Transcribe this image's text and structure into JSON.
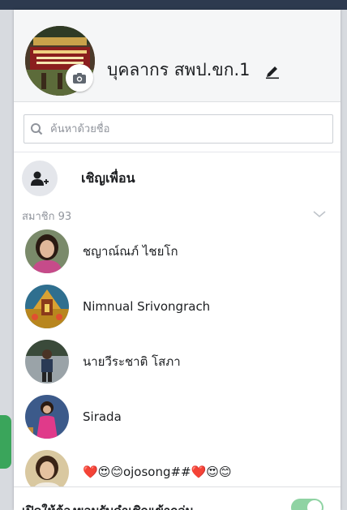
{
  "group": {
    "name": "บุคลากร สพป.ขก.1"
  },
  "search": {
    "placeholder": "ค้นหาด้วยชื่อ"
  },
  "invite": {
    "label": "เชิญเพื่อน"
  },
  "members": {
    "header": "สมาชิก 93",
    "list": [
      {
        "name": "ชญาณ์ณภ์ ไชยโก"
      },
      {
        "name": "Nimnual Srivongrach"
      },
      {
        "name": "นายวีระชาติ  โสภา"
      },
      {
        "name": "Sirada"
      },
      {
        "name": "❤️😍😊ojosong##❤️😍😊"
      }
    ]
  },
  "footer": {
    "label": "เปิดให้ต้องยอมรับคำเชิญเข้ากลุ่ม",
    "toggle_on": true
  },
  "colors": {
    "toggle": "#8fd3a3",
    "header_bg": "#f5f6f7",
    "top_bar": "#2d3a4f"
  }
}
